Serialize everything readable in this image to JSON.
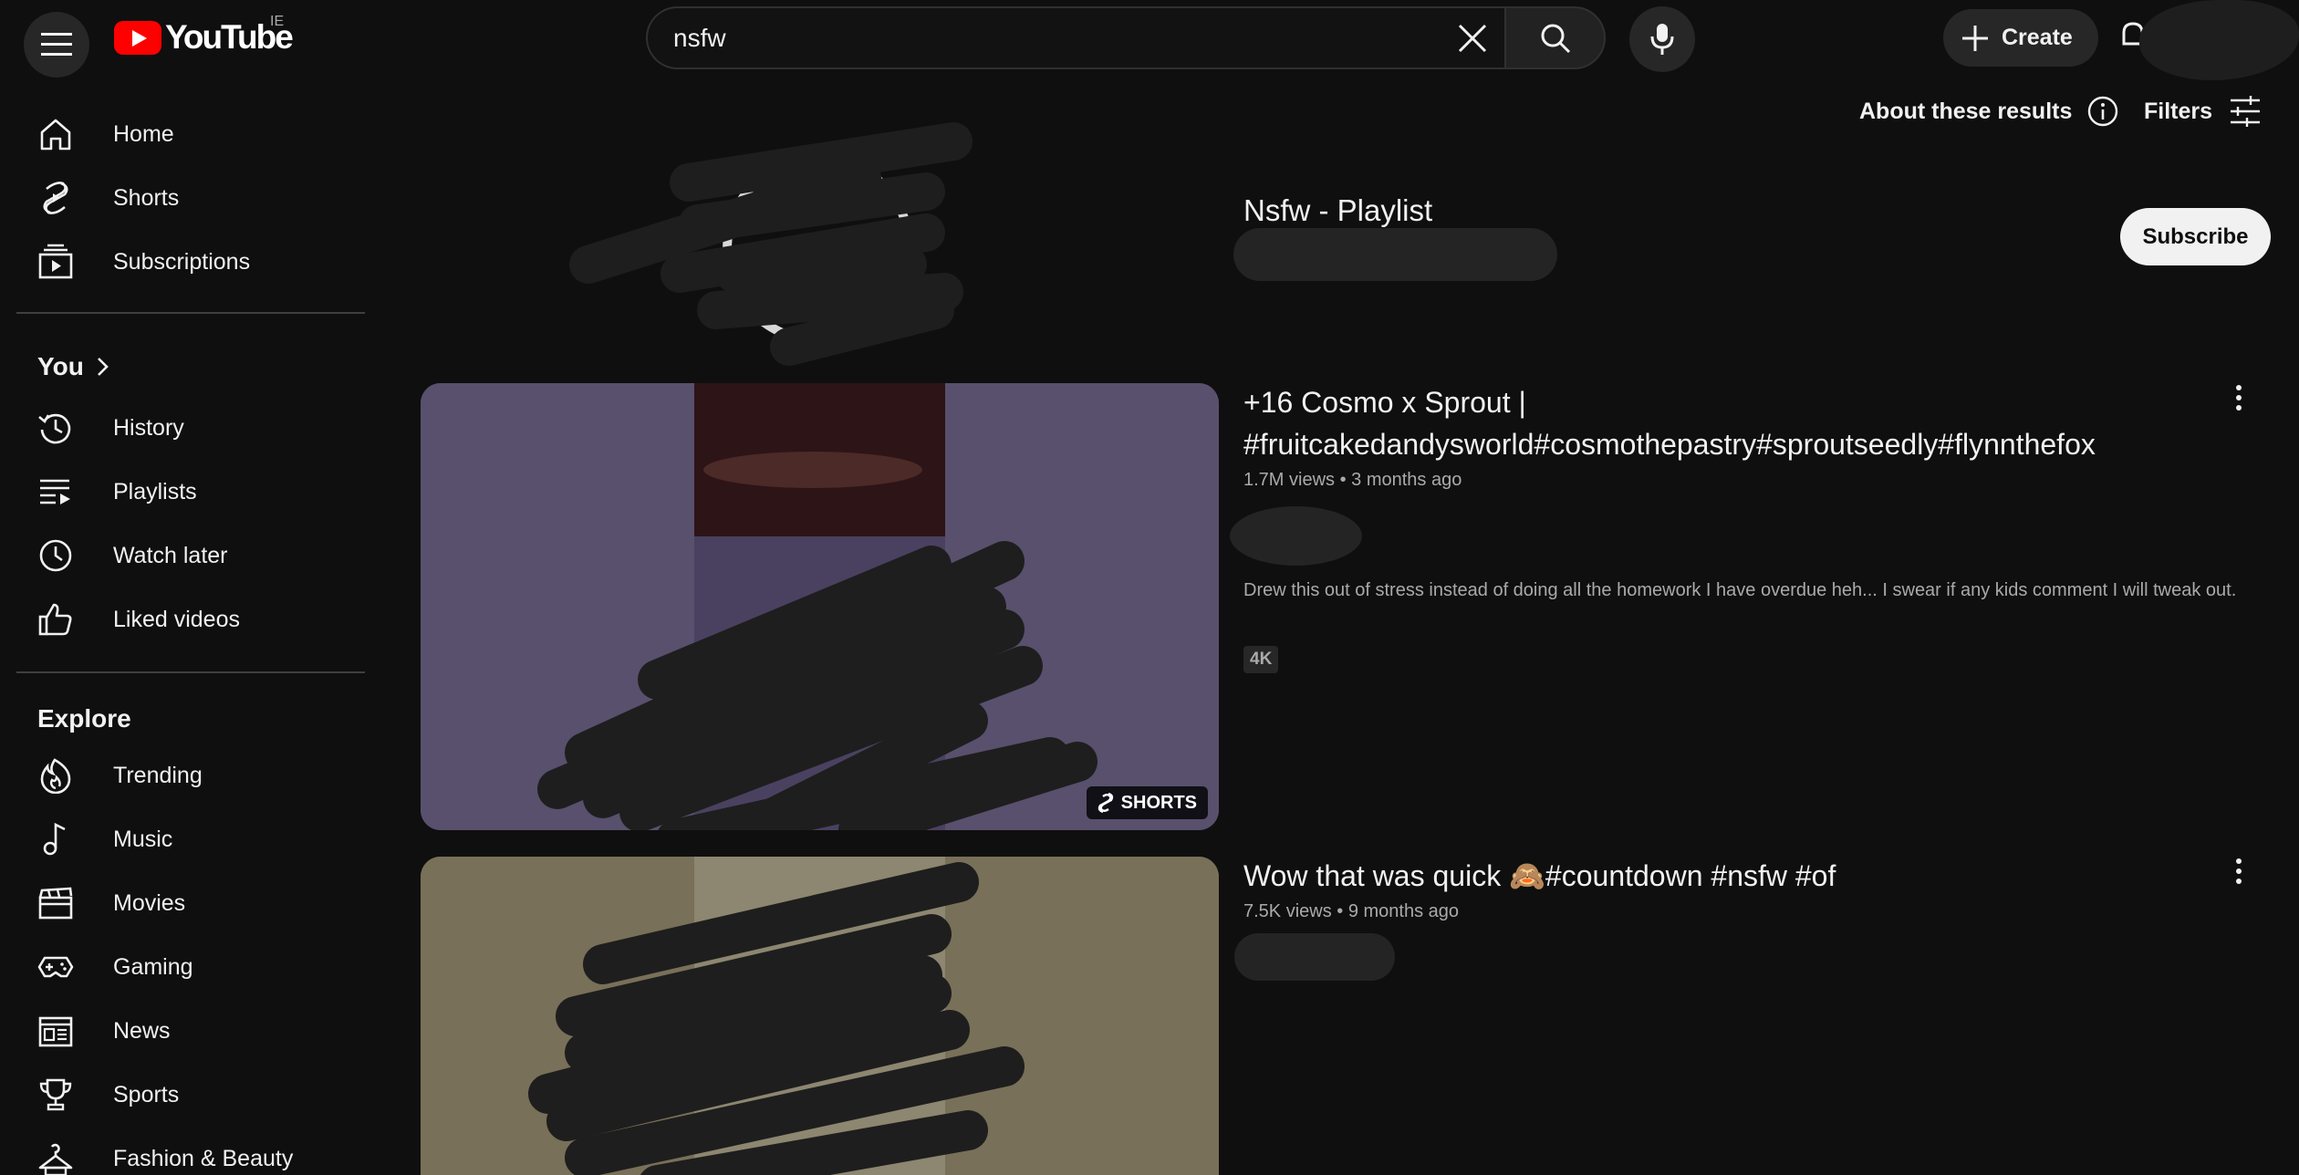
{
  "header": {
    "logo_text": "YouTube",
    "country": "IE",
    "search_value": "nsfw",
    "create_label": "Create"
  },
  "sidebar": {
    "main": [
      {
        "label": "Home",
        "icon": "home-icon"
      },
      {
        "label": "Shorts",
        "icon": "shorts-icon"
      },
      {
        "label": "Subscriptions",
        "icon": "subscriptions-icon"
      }
    ],
    "you_title": "You",
    "you": [
      {
        "label": "History",
        "icon": "history-icon"
      },
      {
        "label": "Playlists",
        "icon": "playlists-icon"
      },
      {
        "label": "Watch later",
        "icon": "watch-later-icon"
      },
      {
        "label": "Liked videos",
        "icon": "thumbs-up-icon"
      }
    ],
    "explore_title": "Explore",
    "explore": [
      {
        "label": "Trending",
        "icon": "trending-icon"
      },
      {
        "label": "Music",
        "icon": "music-icon"
      },
      {
        "label": "Movies",
        "icon": "movies-icon"
      },
      {
        "label": "Gaming",
        "icon": "gaming-icon"
      },
      {
        "label": "News",
        "icon": "news-icon"
      },
      {
        "label": "Sports",
        "icon": "trophy-icon"
      },
      {
        "label": "Fashion & Beauty",
        "icon": "hanger-icon"
      }
    ]
  },
  "results": {
    "about_label": "About these results",
    "filters_label": "Filters",
    "playlist": {
      "title": "Nsfw - Playlist",
      "subscribe_label": "Subscribe"
    },
    "videos": [
      {
        "title": "+16 Cosmo x Sprout | #fruitcakedandysworld#cosmothepastry#sproutseedly#flynnthefox",
        "views": "1.7M views",
        "age": "3 months ago",
        "description": "Drew this out of stress instead of doing all the homework I have overdue heh... I swear if any kids comment I will tweak out.",
        "badge": "4K",
        "overlay": "SHORTS"
      },
      {
        "title": "Wow that was quick 🙈#countdown #nsfw #of",
        "views": "7.5K views",
        "age": "9 months ago"
      }
    ]
  },
  "colors": {
    "background": "#0f0f0f",
    "brand_red": "#ff0000",
    "text_primary": "#f1f1f1",
    "text_secondary": "#aaaaaa"
  }
}
